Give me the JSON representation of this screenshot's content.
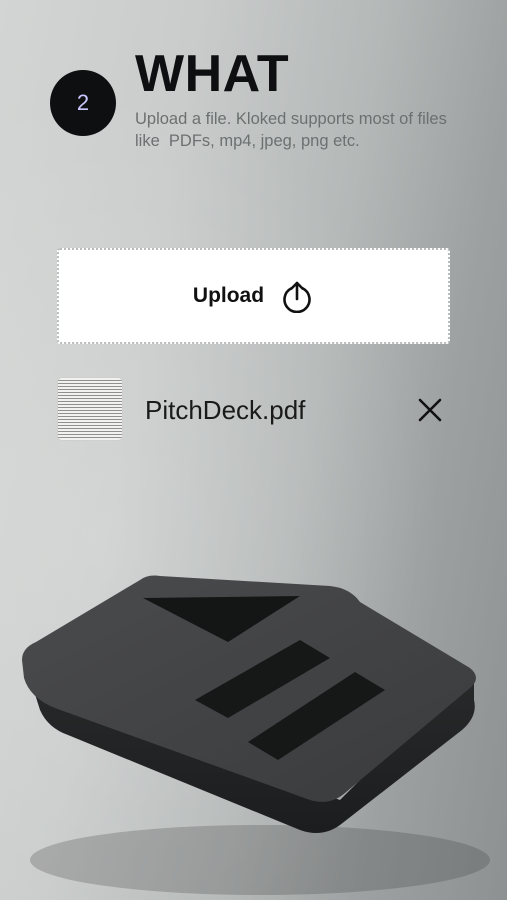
{
  "step": {
    "number": "2",
    "title": "WHAT"
  },
  "description": "Upload a file. Kloked supports most of files like  PDFs, mp4, jpeg, png etc.",
  "upload": {
    "label": "Upload",
    "icon": "upload-icon"
  },
  "file": {
    "name": "PitchDeck.pdf",
    "thumbnail_icon": "document-thumbnail",
    "remove_icon": "close-icon"
  },
  "colors": {
    "step_circle": "#0e0f10",
    "step_number": "#c9c7ff",
    "title": "#0e0f10",
    "description": "#6c7070",
    "upload_bg": "#ffffff"
  }
}
